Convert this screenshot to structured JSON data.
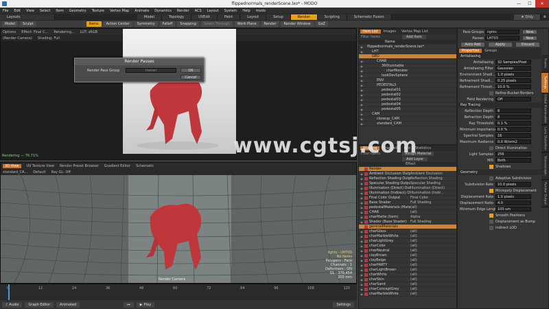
{
  "window": {
    "title": "flippednormals_renderScene.lxo* - MODO",
    "min": "—",
    "max": "☐",
    "close": "✕"
  },
  "menu": [
    "File",
    "Edit",
    "View",
    "Select",
    "Item",
    "Geometry",
    "Texture",
    "Vertex Map",
    "Animate",
    "Dynamics",
    "Render",
    "ACS",
    "Layout",
    "System",
    "Help",
    "modo"
  ],
  "layouts": {
    "label": "Layouts",
    "tabs": [
      "Model",
      "Topology",
      "UVEdit",
      "Paint",
      "Layout",
      "Setup",
      "Render",
      "Scripting",
      "Schematic Fusion"
    ],
    "active": "Render",
    "only": "Only"
  },
  "toolbar": {
    "model": "Model",
    "sculpt": "Sculpt",
    "items": "Items",
    "action_center": "Action Center",
    "symmetry": "Symmetry",
    "falloff": "Falloff",
    "snapping": "Snapping",
    "select_through": "Select Through",
    "work_plane": "Work Plane",
    "render": "Render",
    "render_window": "Render Window",
    "gol": "GoZ"
  },
  "preview": {
    "header": [
      "Options",
      "Effect: Final C...",
      "Rendering...",
      "LUT: sRGB"
    ],
    "sub": [
      "(Render Camera)",
      "Shading: Full"
    ],
    "status": "Rendering — 76.71%"
  },
  "dialog": {
    "title": "Render Passes",
    "label": "Render Pass Group",
    "value": "(none)",
    "ok": "OK",
    "cancel": "Cancel"
  },
  "viewport": {
    "tabs": [
      "3D View",
      "UV Texture View",
      "Render Preset Browser",
      "Gradient Editor",
      "Schematic"
    ],
    "sub": [
      "standard_CA...",
      "Default",
      "Ray GL: Off"
    ],
    "camera_label": "Render Camera",
    "info": [
      "lights - UHT03",
      "No Items",
      "Polygons : Face",
      "Channels : 1",
      "Deformers : ON",
      "GL : 370,454",
      "200 mm"
    ]
  },
  "timeline": {
    "ticks": [
      "0",
      "12",
      "24",
      "36",
      "48",
      "60",
      "72",
      "84",
      "96",
      "108",
      "120"
    ]
  },
  "bottombar": {
    "audio": "Audio",
    "graph_editor": "Graph Editor",
    "animated": "Animated",
    "play": "Play",
    "settings": "Settings"
  },
  "itemlist": {
    "tabs": [
      "Item List",
      "Images",
      "Vertex Map List"
    ],
    "add_item": "Add Item",
    "filter": "Filter Items",
    "col_name": "Name",
    "rows": [
      {
        "name": "flippednormals_renderScene.lxo*",
        "indent": 0
      },
      {
        "name": "LHT",
        "indent": 1
      },
      {
        "name": "GEO",
        "indent": 1,
        "sel": true
      },
      {
        "name": "CHAR",
        "indent": 2
      },
      {
        "name": "360turntable",
        "indent": 3
      },
      {
        "name": "charMonster",
        "indent": 4
      },
      {
        "name": "lookDevSphere",
        "indent": 3
      },
      {
        "name": "ENV",
        "indent": 2
      },
      {
        "name": "PEDESTALS",
        "indent": 2
      },
      {
        "name": "pedestal01",
        "indent": 3
      },
      {
        "name": "pedestal02",
        "indent": 3
      },
      {
        "name": "pedestal03",
        "indent": 3
      },
      {
        "name": "pedestal04",
        "indent": 3
      },
      {
        "name": "pedestal05",
        "indent": 3
      },
      {
        "name": "CAM",
        "indent": 1
      },
      {
        "name": "closeup_CAM",
        "indent": 2
      },
      {
        "name": "standard_CAM",
        "indent": 2
      }
    ]
  },
  "shading": {
    "tabs": [
      "Shading",
      "Channels",
      "Info & Statistics"
    ],
    "add_layer": "Add Layer",
    "assign_material": "Assign Material",
    "filter": "Filter Items",
    "col_effect": "Effect",
    "rows": [
      {
        "name": "Render",
        "effect": "",
        "sel": true
      },
      {
        "name": "Ambient Occlusion Output",
        "effect": "Ambient Occlusion"
      },
      {
        "name": "Reflection Shading Output",
        "effect": "Reflection Shading"
      },
      {
        "name": "Specular Shading Output",
        "effect": "Specular Shading"
      },
      {
        "name": "Illumination (Direct) Output",
        "effect": "Illumination (Direct)"
      },
      {
        "name": "Illumination (Indirect) Output",
        "effect": "Illumination (Indir..."
      },
      {
        "name": "Final Color Output",
        "effect": "Final Color"
      },
      {
        "name": "Base Shader",
        "effect": "Full Shading"
      },
      {
        "name": "pedestalMaterials (Material)",
        "effect": "(all)"
      },
      {
        "name": "CHAR",
        "effect": "(all)"
      },
      {
        "name": "charMatte (Item)",
        "effect": "Alpha"
      },
      {
        "name": "Shader (Base Shader)",
        "effect": "Full Shading"
      },
      {
        "name": "generalMaterials",
        "effect": "",
        "sel": true
      },
      {
        "name": "charGlass",
        "effect": "(all)"
      },
      {
        "name": "charMarbleWhite",
        "effect": "(all)"
      },
      {
        "name": "charLightGrey",
        "effect": "(all)"
      },
      {
        "name": "charColor",
        "effect": "(all)"
      },
      {
        "name": "charNeutral",
        "effect": "(all)"
      },
      {
        "name": "clayBrown",
        "effect": "(all)"
      },
      {
        "name": "clayBeige",
        "effect": "(all)"
      },
      {
        "name": "charPARTY",
        "effect": "(all)"
      },
      {
        "name": "charLightBrown",
        "effect": "(all)"
      },
      {
        "name": "charWhite",
        "effect": "(all)"
      },
      {
        "name": "charSkin",
        "effect": "(all)"
      },
      {
        "name": "charSand",
        "effect": "(all)"
      },
      {
        "name": "charConceptGrey",
        "effect": "(all)"
      },
      {
        "name": "charMarbleWhite",
        "effect": "(all)"
      }
    ]
  },
  "passes": {
    "groups_label": "Pass Groups",
    "groups_value": "lights",
    "passes_label": "Passes",
    "passes_value": "LHT03",
    "new": "New",
    "auto_add": "Auto Add",
    "apply": "Apply",
    "discard": "Discard"
  },
  "properties": {
    "tabs": [
      "Properties",
      "Groups"
    ],
    "sections": [
      {
        "title": "Antialiasing",
        "props": [
          {
            "label": "Antialiasing",
            "value": "32 Samples/Pixel"
          },
          {
            "label": "Antialiasing Filter",
            "value": "Gaussian"
          }
        ]
      },
      {
        "title": "",
        "props": [
          {
            "label": "Environment Shadi...",
            "value": "1.0 pixels"
          },
          {
            "label": "Refinement Shadi...",
            "value": "0.25 pixels"
          },
          {
            "label": "Refinement Thresh...",
            "value": "10.0 %"
          }
        ]
      },
      {
        "title": "",
        "checks": [
          {
            "label": "Refine Bucket Borders",
            "on": false
          }
        ]
      },
      {
        "title": "",
        "props": [
          {
            "label": "Field Rendering",
            "value": "Off"
          }
        ]
      },
      {
        "title": "Ray Tracing",
        "props": [
          {
            "label": "Reflection Depth",
            "value": "8"
          },
          {
            "label": "Refraction Depth",
            "value": "8"
          },
          {
            "label": "Ray Threshold",
            "value": "0.1 %"
          },
          {
            "label": "Minimum Importance",
            "value": "0.0 %"
          },
          {
            "label": "Spectral Samples",
            "value": "16"
          },
          {
            "label": "Maximum Radiance",
            "value": "0.0 W/srm2"
          }
        ]
      },
      {
        "title": "",
        "checks": [
          {
            "label": "Direct Illumination",
            "on": false
          }
        ]
      },
      {
        "title": "",
        "props": [
          {
            "label": "Light Samples",
            "value": "256"
          },
          {
            "label": "MIS",
            "value": "Both"
          }
        ]
      },
      {
        "title": "",
        "checks": [
          {
            "label": "Shadows",
            "on": true
          }
        ]
      },
      {
        "title": "Geometry",
        "checks": [
          {
            "label": "Adaptive Subdivision",
            "on": false
          }
        ]
      },
      {
        "title": "",
        "props": [
          {
            "label": "Subdivision Rate",
            "value": "10.0 pixels"
          }
        ]
      },
      {
        "title": "",
        "checks": [
          {
            "label": "Micropoly Displacement",
            "on": true
          }
        ]
      },
      {
        "title": "",
        "props": [
          {
            "label": "Displacement Rate",
            "value": "1.0 pixels"
          },
          {
            "label": "Displacement Ratio",
            "value": "4.0"
          },
          {
            "label": "Minimum Edge Length",
            "value": "100 um"
          }
        ]
      },
      {
        "title": "",
        "checks": [
          {
            "label": "Smooth Positions",
            "on": true
          },
          {
            "label": "Displacement as Bump",
            "on": false
          },
          {
            "label": "Indirect LOD",
            "on": false
          }
        ]
      }
    ]
  },
  "vtabs": [
    "Frame",
    "Settings",
    "Global Illumination",
    "Lens Distortion",
    "Stereoscopic",
    "Render Output"
  ],
  "watermark": "www.cgtsj.com"
}
